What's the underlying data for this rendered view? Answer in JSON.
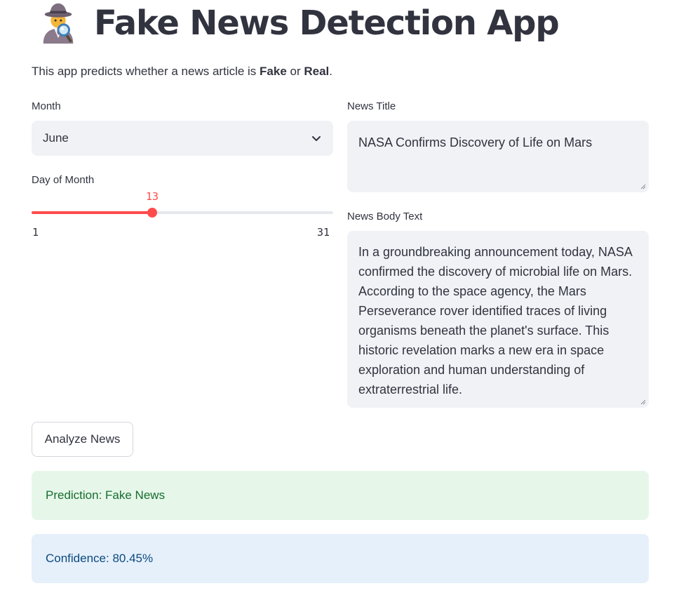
{
  "header": {
    "icon": "detective-icon",
    "title": "Fake News Detection App"
  },
  "description": {
    "prefix": "This app predicts whether a news article is ",
    "fake": "Fake",
    "or": " or ",
    "real": "Real",
    "suffix": "."
  },
  "month": {
    "label": "Month",
    "selected": "June",
    "icon": "chevron-down-icon"
  },
  "day": {
    "label": "Day of Month",
    "value": "13",
    "min": "1",
    "max": "31",
    "accent": "#ff4b4b"
  },
  "news_title": {
    "label": "News Title",
    "value": "NASA Confirms Discovery of Life on Mars"
  },
  "news_body": {
    "label": "News Body Text",
    "value": "In a groundbreaking announcement today, NASA confirmed the discovery of microbial life on Mars. According to the space agency, the Mars Perseverance rover identified traces of living organisms beneath the planet's surface. This historic revelation marks a new era in space exploration and human understanding of extraterrestrial life."
  },
  "analyze_button": {
    "label": "Analyze News"
  },
  "results": {
    "prediction": "Prediction: Fake News",
    "confidence": "Confidence: 80.45%",
    "success_color": "#176c2e",
    "info_color": "#0b4a7f"
  }
}
